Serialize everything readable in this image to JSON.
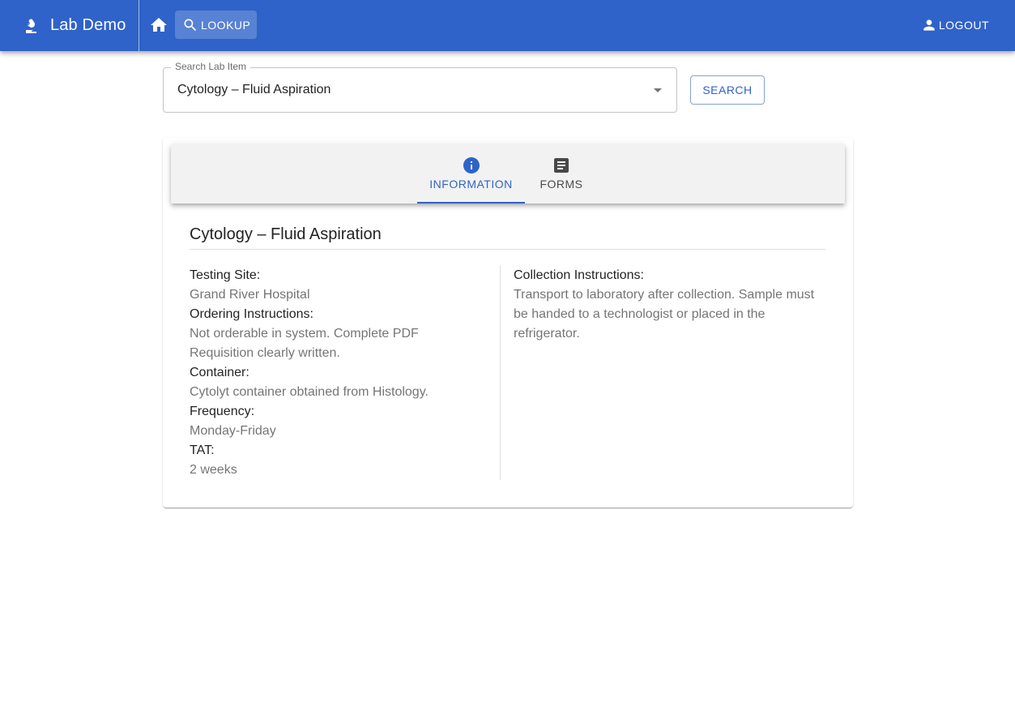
{
  "app": {
    "title": "Lab Demo",
    "lookup_label": "LOOKUP",
    "logout_label": "LOGOUT"
  },
  "search": {
    "label": "Search Lab Item",
    "value": "Cytology – Fluid Aspiration",
    "button_label": "SEARCH"
  },
  "tabs": [
    {
      "label": "INFORMATION",
      "icon": "info-icon",
      "active": true
    },
    {
      "label": "FORMS",
      "icon": "document-icon",
      "active": false
    }
  ],
  "item": {
    "title": "Cytology – Fluid Aspiration",
    "left_fields": [
      {
        "label": "Testing Site:",
        "value": "Grand River Hospital"
      },
      {
        "label": "Ordering Instructions:",
        "value": "Not orderable in system. Complete PDF Requisition clearly written."
      },
      {
        "label": "Container:",
        "value": "Cytolyt container obtained from Histology."
      },
      {
        "label": "Frequency:",
        "value": "Monday-Friday"
      },
      {
        "label": "TAT:",
        "value": "2 weeks"
      }
    ],
    "right_fields": [
      {
        "label": "Collection Instructions:",
        "value": "Transport to laboratory after collection. Sample must be handed to a technologist or placed in the refrigerator."
      }
    ]
  },
  "colors": {
    "primary": "#2f63c9",
    "tab_bar_bg": "#f2f2f2"
  }
}
